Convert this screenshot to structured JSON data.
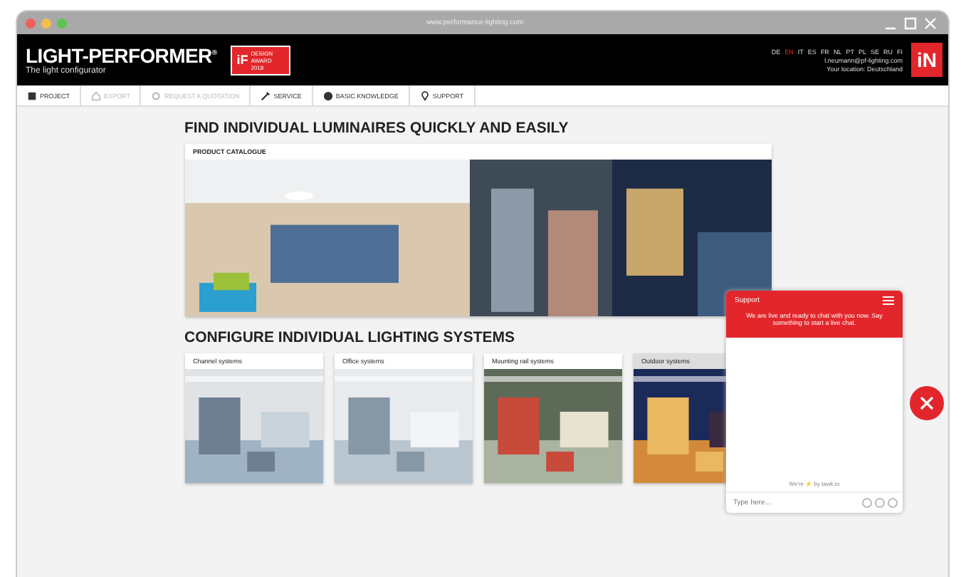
{
  "window": {
    "url": "www.performance-lighting.com"
  },
  "header": {
    "logo": "LIGHT-PERFORMER",
    "logo_mark": "®",
    "tagline": "The light configurator",
    "award": [
      "iF",
      "DESIGN AWARD 2018"
    ],
    "languages": [
      {
        "label": "DE",
        "selected": false
      },
      {
        "label": "EN",
        "selected": true
      },
      {
        "label": "IT",
        "selected": false
      },
      {
        "label": "ES",
        "selected": false
      },
      {
        "label": "FR",
        "selected": false
      },
      {
        "label": "NL",
        "selected": false
      },
      {
        "label": "PT",
        "selected": false
      },
      {
        "label": "PL",
        "selected": false
      },
      {
        "label": "SE",
        "selected": false
      },
      {
        "label": "RU",
        "selected": false
      },
      {
        "label": "FI",
        "selected": false
      }
    ],
    "user": "l.neumann@pf-lighting.com",
    "location": "Your location: Deutschland",
    "brand": "iN"
  },
  "nav": [
    {
      "label": "PROJECT",
      "disabled": false
    },
    {
      "label": "EXPORT",
      "disabled": true
    },
    {
      "label": "REQUEST A QUOTATION",
      "disabled": true
    },
    {
      "label": "SERVICE",
      "disabled": false
    },
    {
      "label": "BASIC KNOWLEDGE",
      "disabled": false
    },
    {
      "label": "SUPPORT",
      "disabled": false
    }
  ],
  "heading_1": "FIND INDIVIDUAL LUMINAIRES QUICKLY AND EASILY",
  "catalogue": {
    "title": "PRODUCT CATALOGUE"
  },
  "heading_2": "CONFIGURE INDIVIDUAL LIGHTING SYSTEMS",
  "systems": [
    {
      "title": "Channel systems",
      "selected": false
    },
    {
      "title": "Office systems",
      "selected": false
    },
    {
      "title": "Mounting rail systems",
      "selected": false
    },
    {
      "title": "Outdoor systems",
      "selected": true
    }
  ],
  "chat": {
    "title": "Support",
    "message": "We are live and ready to chat with you now. Say something to start a live chat.",
    "footer": "We're ⚡ by tawk.to",
    "placeholder": "Type here..."
  }
}
